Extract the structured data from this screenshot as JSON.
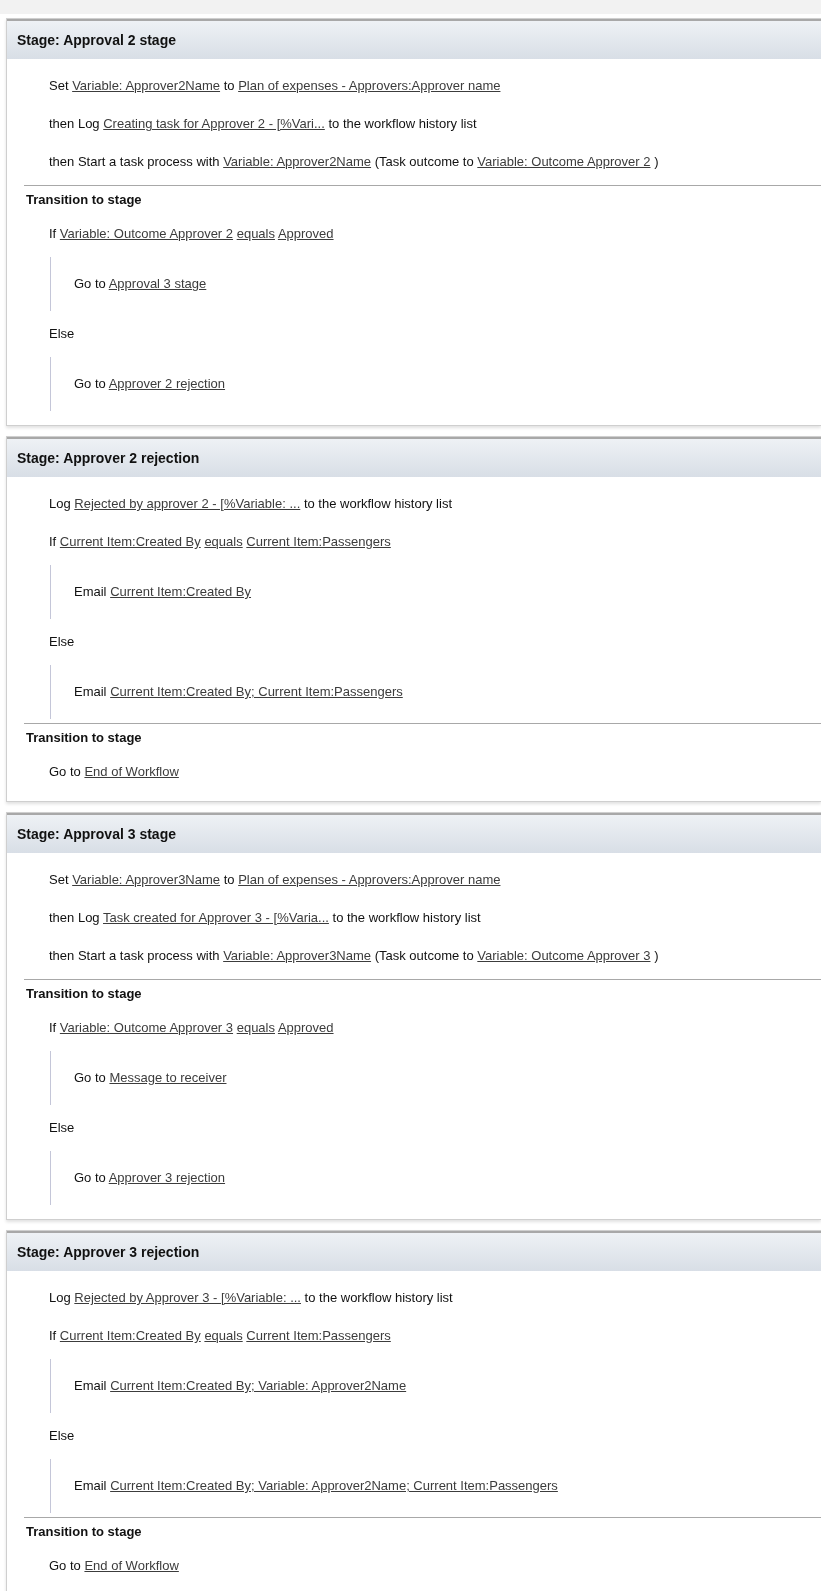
{
  "stages": [
    {
      "title": "Stage: Approval 2 stage",
      "actions": [
        {
          "kind": "line",
          "parts": [
            {
              "kind": "text",
              "text": "Set"
            },
            {
              "kind": "link",
              "text": "Variable: Approver2Name"
            },
            {
              "kind": "text",
              "text": "to"
            },
            {
              "kind": "link",
              "text": "Plan of expenses - Approvers:Approver name"
            }
          ]
        },
        {
          "kind": "line",
          "parts": [
            {
              "kind": "text",
              "text": "then Log"
            },
            {
              "kind": "link",
              "text": "Creating task for Approver 2 - [%Vari..."
            },
            {
              "kind": "text",
              "text": "to the workflow history list"
            }
          ]
        },
        {
          "kind": "line",
          "parts": [
            {
              "kind": "text",
              "text": "then Start a task process with"
            },
            {
              "kind": "link",
              "text": "Variable: Approver2Name"
            },
            {
              "kind": "text",
              "text": "(Task outcome to"
            },
            {
              "kind": "link",
              "text": "Variable: Outcome Approver 2"
            },
            {
              "kind": "text",
              "text": ")"
            }
          ]
        }
      ],
      "transition": {
        "heading": "Transition to stage",
        "items": [
          {
            "kind": "line",
            "parts": [
              {
                "kind": "text",
                "text": "If"
              },
              {
                "kind": "link",
                "text": "Variable: Outcome Approver 2"
              },
              {
                "kind": "link",
                "text": "equals"
              },
              {
                "kind": "link",
                "text": "Approved"
              }
            ]
          },
          {
            "kind": "block",
            "parts": [
              {
                "kind": "text",
                "text": "Go to"
              },
              {
                "kind": "link",
                "text": "Approval 3 stage"
              }
            ]
          },
          {
            "kind": "line",
            "parts": [
              {
                "kind": "text",
                "text": "Else"
              }
            ]
          },
          {
            "kind": "block",
            "parts": [
              {
                "kind": "text",
                "text": "Go to"
              },
              {
                "kind": "link",
                "text": "Approver 2 rejection"
              }
            ]
          }
        ]
      }
    },
    {
      "title": "Stage: Approver 2 rejection",
      "actions": [
        {
          "kind": "line",
          "parts": [
            {
              "kind": "text",
              "text": "Log"
            },
            {
              "kind": "link",
              "text": "Rejected by approver 2 - [%Variable: ..."
            },
            {
              "kind": "text",
              "text": "to the workflow history list"
            }
          ]
        },
        {
          "kind": "line",
          "parts": [
            {
              "kind": "text",
              "text": "If"
            },
            {
              "kind": "link",
              "text": "Current Item:Created By"
            },
            {
              "kind": "link",
              "text": "equals"
            },
            {
              "kind": "link",
              "text": "Current Item:Passengers"
            }
          ]
        },
        {
          "kind": "block",
          "parts": [
            {
              "kind": "text",
              "text": "Email"
            },
            {
              "kind": "link",
              "text": "Current Item:Created By"
            }
          ]
        },
        {
          "kind": "line",
          "parts": [
            {
              "kind": "text",
              "text": "Else"
            }
          ]
        },
        {
          "kind": "block",
          "parts": [
            {
              "kind": "text",
              "text": "Email"
            },
            {
              "kind": "link",
              "text": "Current Item:Created By; Current Item:Passengers"
            }
          ]
        }
      ],
      "transition": {
        "heading": "Transition to stage",
        "items": [
          {
            "kind": "line",
            "parts": [
              {
                "kind": "text",
                "text": "Go to"
              },
              {
                "kind": "link",
                "text": "End of Workflow"
              }
            ]
          }
        ]
      }
    },
    {
      "title": "Stage: Approval 3 stage",
      "actions": [
        {
          "kind": "line",
          "parts": [
            {
              "kind": "text",
              "text": "Set"
            },
            {
              "kind": "link",
              "text": "Variable: Approver3Name"
            },
            {
              "kind": "text",
              "text": "to"
            },
            {
              "kind": "link",
              "text": "Plan of expenses - Approvers:Approver name"
            }
          ]
        },
        {
          "kind": "line",
          "parts": [
            {
              "kind": "text",
              "text": "then Log"
            },
            {
              "kind": "link",
              "text": "Task created for Approver 3 - [%Varia..."
            },
            {
              "kind": "text",
              "text": "to the workflow history list"
            }
          ]
        },
        {
          "kind": "line",
          "parts": [
            {
              "kind": "text",
              "text": "then Start a task process with"
            },
            {
              "kind": "link",
              "text": "Variable: Approver3Name"
            },
            {
              "kind": "text",
              "text": "(Task outcome to"
            },
            {
              "kind": "link",
              "text": "Variable: Outcome Approver 3"
            },
            {
              "kind": "text",
              "text": ")"
            }
          ]
        }
      ],
      "transition": {
        "heading": "Transition to stage",
        "items": [
          {
            "kind": "line",
            "parts": [
              {
                "kind": "text",
                "text": "If"
              },
              {
                "kind": "link",
                "text": "Variable: Outcome Approver 3"
              },
              {
                "kind": "link",
                "text": "equals"
              },
              {
                "kind": "link",
                "text": "Approved"
              }
            ]
          },
          {
            "kind": "block",
            "parts": [
              {
                "kind": "text",
                "text": "Go to"
              },
              {
                "kind": "link",
                "text": "Message to receiver"
              }
            ]
          },
          {
            "kind": "line",
            "parts": [
              {
                "kind": "text",
                "text": "Else"
              }
            ]
          },
          {
            "kind": "block",
            "parts": [
              {
                "kind": "text",
                "text": "Go to"
              },
              {
                "kind": "link",
                "text": "Approver 3 rejection"
              }
            ]
          }
        ]
      }
    },
    {
      "title": "Stage: Approver 3 rejection",
      "actions": [
        {
          "kind": "line",
          "parts": [
            {
              "kind": "text",
              "text": "Log"
            },
            {
              "kind": "link",
              "text": "Rejected by Approver 3 - [%Variable: ..."
            },
            {
              "kind": "text",
              "text": "to the workflow history list"
            }
          ]
        },
        {
          "kind": "line",
          "parts": [
            {
              "kind": "text",
              "text": "If"
            },
            {
              "kind": "link",
              "text": "Current Item:Created By"
            },
            {
              "kind": "link",
              "text": "equals"
            },
            {
              "kind": "link",
              "text": "Current Item:Passengers"
            }
          ]
        },
        {
          "kind": "block",
          "parts": [
            {
              "kind": "text",
              "text": "Email"
            },
            {
              "kind": "link",
              "text": "Current Item:Created By; Variable: Approver2Name"
            }
          ]
        },
        {
          "kind": "line",
          "parts": [
            {
              "kind": "text",
              "text": "Else"
            }
          ]
        },
        {
          "kind": "block",
          "parts": [
            {
              "kind": "text",
              "text": "Email"
            },
            {
              "kind": "link",
              "text": "Current Item:Created By; Variable: Approver2Name; Current Item:Passengers"
            }
          ]
        }
      ],
      "transition": {
        "heading": "Transition to stage",
        "items": [
          {
            "kind": "line",
            "parts": [
              {
                "kind": "text",
                "text": "Go to"
              },
              {
                "kind": "link",
                "text": "End of Workflow"
              }
            ]
          }
        ]
      }
    }
  ]
}
